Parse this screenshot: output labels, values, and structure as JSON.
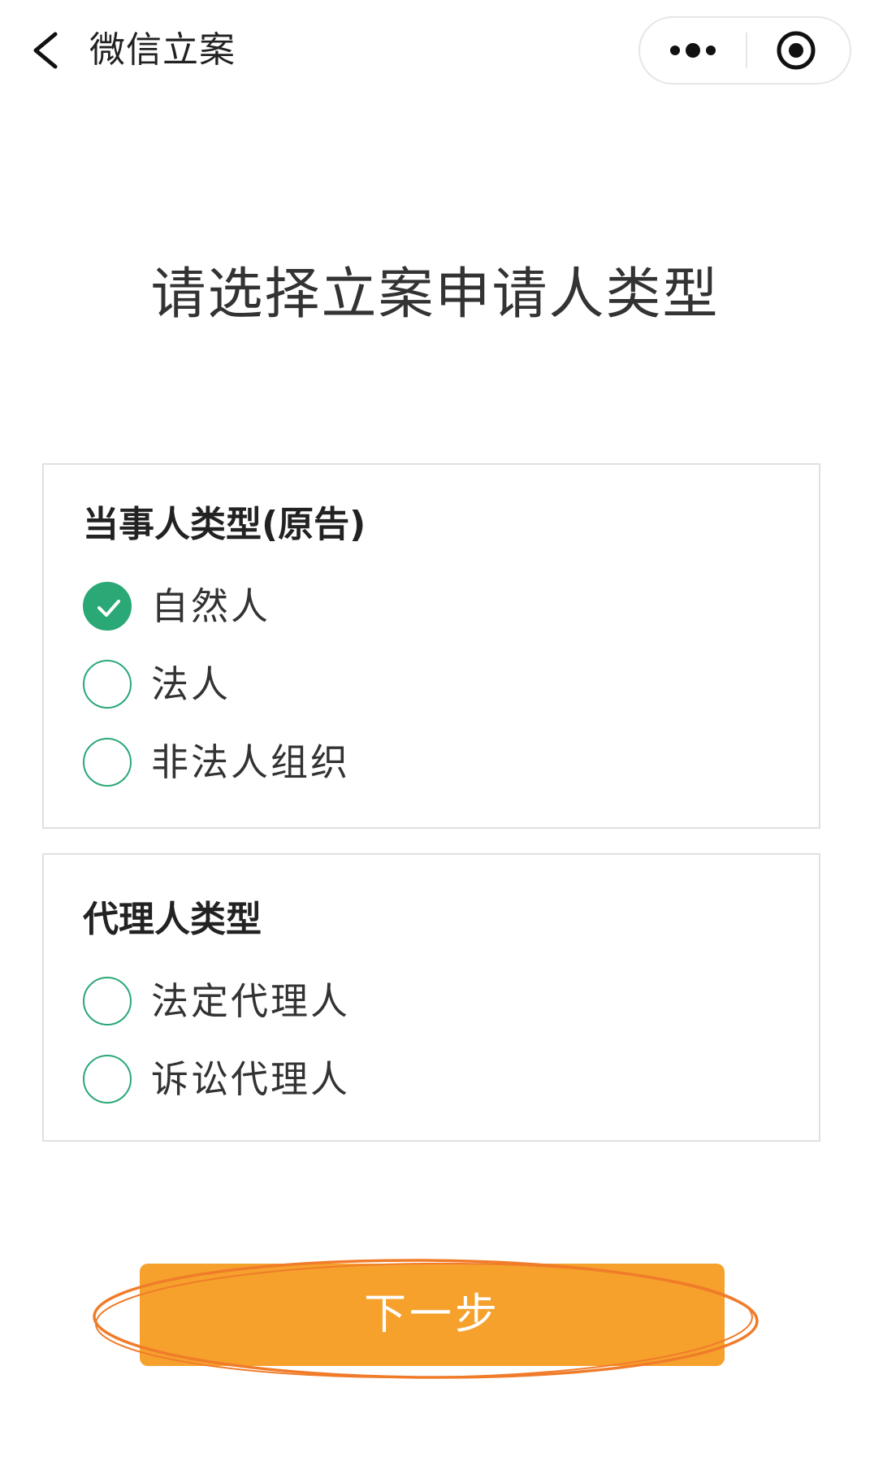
{
  "navbar": {
    "title": "微信立案",
    "back_icon": "chevron-left-icon",
    "more_icon": "more-dots-icon",
    "close_icon": "target-close-icon"
  },
  "page": {
    "title": "请选择立案申请人类型"
  },
  "party_section": {
    "heading": "当事人类型(原告)",
    "options": [
      {
        "label": "自然人",
        "checked": true
      },
      {
        "label": "法人",
        "checked": false
      },
      {
        "label": "非法人组织",
        "checked": false
      }
    ]
  },
  "agent_section": {
    "heading": "代理人类型",
    "options": [
      {
        "label": "法定代理人",
        "checked": false
      },
      {
        "label": "诉讼代理人",
        "checked": false
      }
    ]
  },
  "actions": {
    "next_label": "下一步"
  },
  "colors": {
    "accent_green": "#2aa876",
    "button_orange": "#f5a12c",
    "highlight_ellipse": "#f07c2a"
  }
}
